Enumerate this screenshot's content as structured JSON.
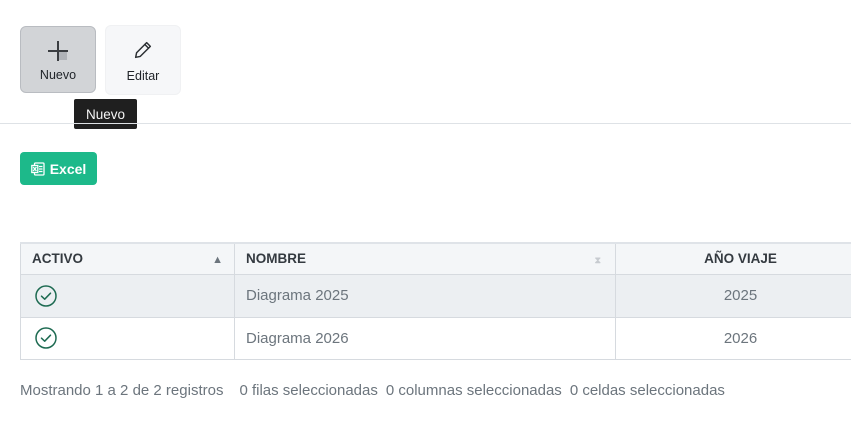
{
  "toolbar": {
    "nuevo_label": "Nuevo",
    "editar_label": "Editar"
  },
  "tooltip": {
    "text": "Nuevo"
  },
  "export": {
    "excel_label": "Excel"
  },
  "table": {
    "headers": [
      "ACTIVO",
      "NOMBRE",
      "AÑO VIAJE"
    ],
    "sort": {
      "column": "ACTIVO",
      "direction": "ascending"
    },
    "rows": [
      {
        "activo": "check-circle-icon",
        "nombre": "Diagrama 2025",
        "anio": "2025"
      },
      {
        "activo": "check-circle-icon",
        "nombre": "Diagrama 2026",
        "anio": "2026"
      }
    ]
  },
  "footer": {
    "info": "Mostrando 1 a 2 de 2 registros",
    "rows_selected": "0 filas seleccionadas",
    "cols_selected": "0 columnas seleccionadas",
    "cells_selected": "0 celdas seleccionadas"
  },
  "colors": {
    "excel_button": "#1db98a",
    "check_icon": "#1e6b52",
    "tooltip_bg": "#1f1f1f"
  }
}
